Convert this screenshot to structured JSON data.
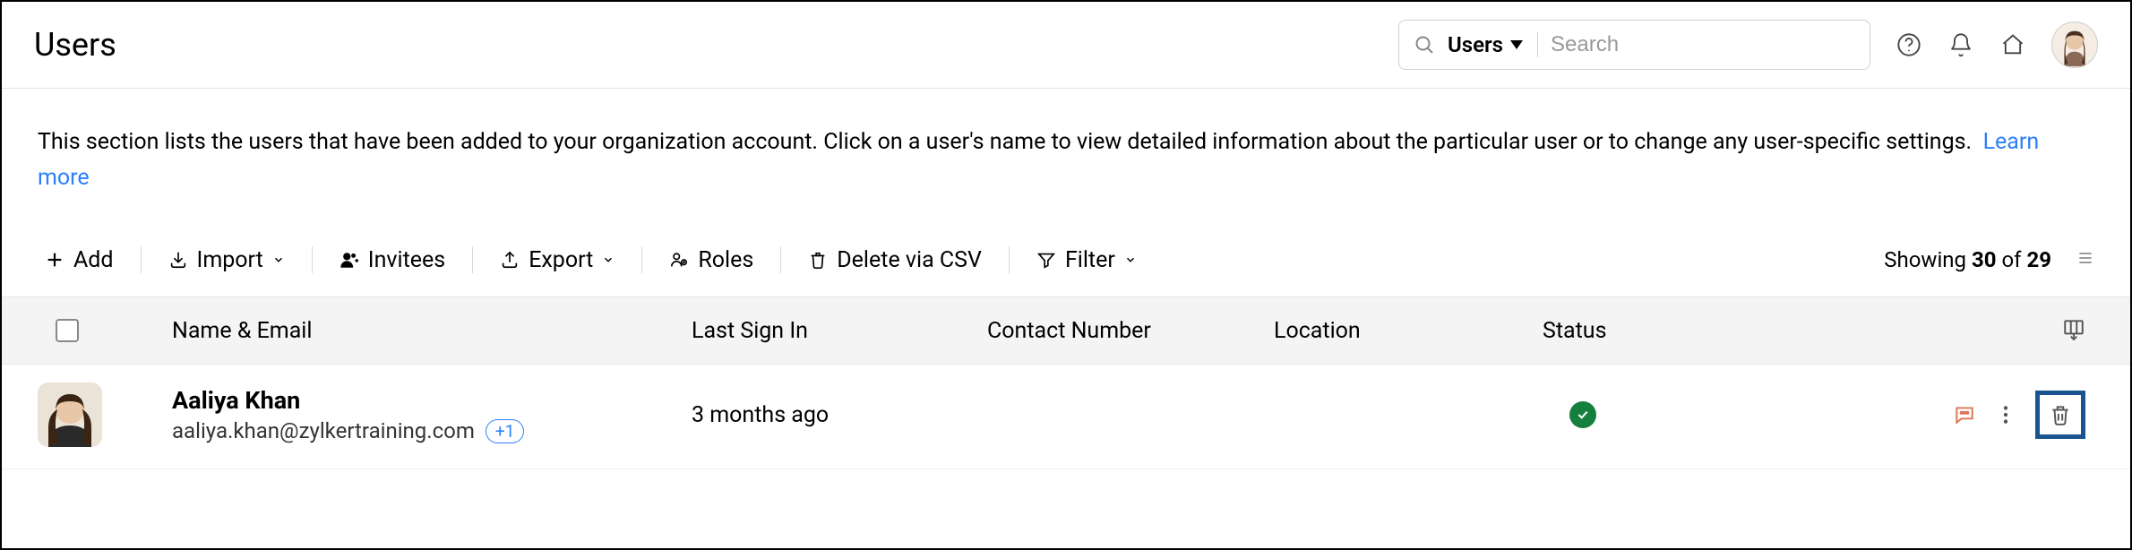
{
  "header": {
    "title": "Users",
    "search": {
      "entity_label": "Users",
      "placeholder": "Search"
    }
  },
  "description": {
    "text": "This section lists the users that have been added to your organization account. Click on a user's name to view detailed information about the particular user or to change any user-specific settings.",
    "learn_more": "Learn more"
  },
  "toolbar": {
    "add": "Add",
    "import": "Import",
    "invitees": "Invitees",
    "export": "Export",
    "roles": "Roles",
    "delete_csv": "Delete via CSV",
    "filter": "Filter",
    "showing_prefix": "Showing ",
    "showing_current": "30",
    "showing_mid": " of ",
    "showing_total": "29"
  },
  "table": {
    "columns": {
      "name": "Name & Email",
      "signin": "Last Sign In",
      "contact": "Contact Number",
      "location": "Location",
      "status": "Status"
    },
    "rows": [
      {
        "name": "Aaliya Khan",
        "email": "aaliya.khan@zylkertraining.com",
        "extra_count": "+1",
        "last_signin": "3 months ago",
        "contact": "",
        "location": "",
        "status_ok": true
      }
    ]
  }
}
